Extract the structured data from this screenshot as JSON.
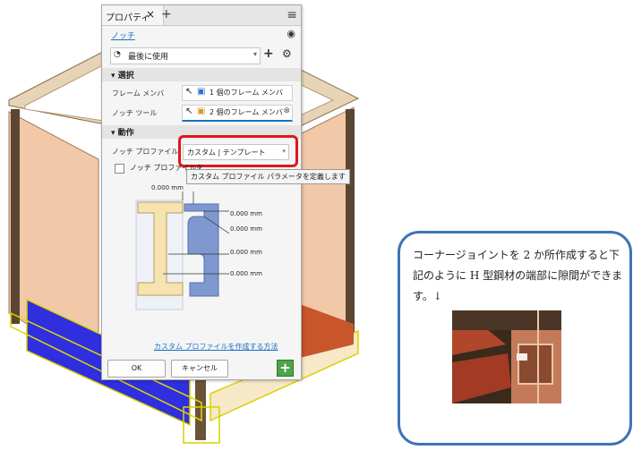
{
  "panel": {
    "tab_label": "プロパティ",
    "tab_close": "×",
    "tab_add": "+",
    "menu_icon": "hamburger-icon",
    "feature_link": "ノッチ",
    "preset": "最後に使用",
    "sections": {
      "selection": "選択",
      "action": "動作"
    },
    "frame_member_label": "フレーム メンバ",
    "frame_member_value": "1 個のフレーム メンバ",
    "notch_tool_label": "ノッチ ツール",
    "notch_tool_value": "2 個のフレーム メンバ",
    "notch_profile_label": "ノッチ プロファイル",
    "notch_profile_value": "カスタム | テンプレート",
    "checkbox_label": "ノッチ プロファイルを",
    "tooltip": "カスタム プロファイル パラメータを定義します",
    "dims": [
      "0.000 mm",
      "0.000 mm",
      "0.000 mm",
      "0.000 mm",
      "0.000 mm"
    ],
    "create_link": "カスタム プロファイルを作成する方法",
    "ok": "OK",
    "cancel": "キャンセル",
    "green_plus": "+"
  },
  "callout": {
    "text": "コーナージョイントを 2 か所作成すると下記のように H 型鋼材の端部に隙間ができます。↓"
  },
  "colors": {
    "accent": "#1a6fc2",
    "highlight": "#e0181e",
    "frame_blue": "#2b2bd6",
    "callout_border": "#3f74b7"
  }
}
